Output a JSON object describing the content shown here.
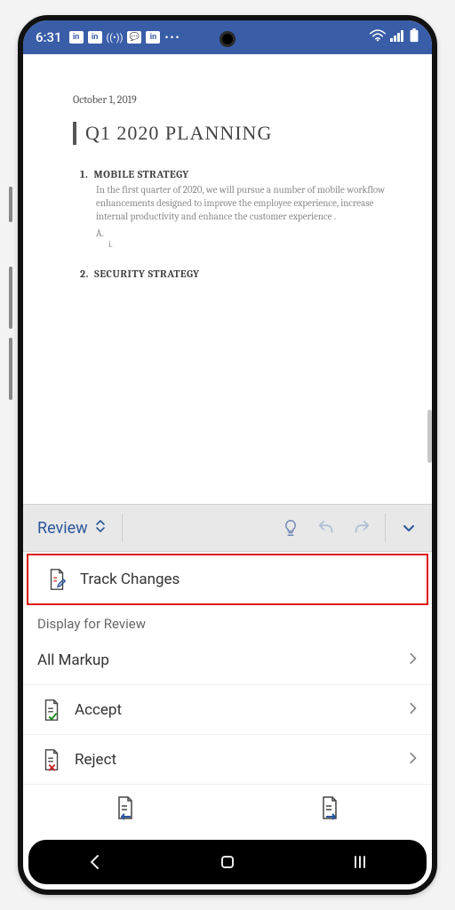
{
  "status": {
    "time": "6:31",
    "apps": [
      "in",
      "in",
      "((•))",
      "💬",
      "in"
    ],
    "more": "•••"
  },
  "document": {
    "date": "October 1, 2019",
    "title": "Q1 2020 PLANNING",
    "sections": [
      {
        "num": "1.",
        "heading": "MOBILE STRATEGY",
        "body": "In the first quarter of 2020, we will pursue a number of mobile workflow enhancements designed to improve the employee experience, increase internal productivity and enhance the customer experience .",
        "sub": "A.",
        "subsub": "i."
      },
      {
        "num": "2.",
        "heading": "SECURITY STRATEGY",
        "body": "",
        "sub": "",
        "subsub": ""
      }
    ]
  },
  "ribbon": {
    "tab": "Review"
  },
  "options": {
    "track_changes": "Track Changes",
    "display_for_review": "Display for Review",
    "all_markup": "All Markup",
    "accept": "Accept",
    "reject": "Reject"
  },
  "icons": {
    "track": "track-changes-icon",
    "accept": "accept-icon",
    "reject": "reject-icon",
    "prev": "previous-change-icon",
    "next": "next-change-icon",
    "bulb": "tell-me-icon",
    "undo": "undo-icon",
    "redo": "redo-icon",
    "expand": "expand-icon"
  },
  "colors": {
    "accent": "#2b579a",
    "highlight": "#d11"
  }
}
